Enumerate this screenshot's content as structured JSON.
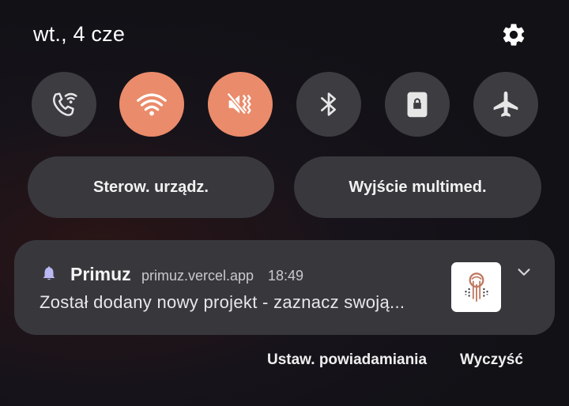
{
  "status": {
    "date": "wt., 4 cze"
  },
  "quick_settings": [
    {
      "icon": "wifi-calling-icon",
      "state": "off"
    },
    {
      "icon": "wifi-icon",
      "state": "on"
    },
    {
      "icon": "sound-vibrate-icon",
      "state": "on"
    },
    {
      "icon": "bluetooth-icon",
      "state": "off"
    },
    {
      "icon": "portrait-lock-icon",
      "state": "off"
    },
    {
      "icon": "airplane-icon",
      "state": "off"
    }
  ],
  "panels": {
    "device_control": "Sterow. urządz.",
    "media_output": "Wyjście multimed."
  },
  "notification": {
    "app": "Primuz",
    "source": "primuz.vercel.app",
    "time": "18:49",
    "text": "Został dodany nowy projekt - zaznacz swoją..."
  },
  "actions": {
    "settings": "Ustaw. powiadamiania",
    "clear": "Wyczyść"
  },
  "colors": {
    "accent": "#ea8b6b",
    "tile_off": "#3c3c41",
    "card": "#38383c"
  }
}
